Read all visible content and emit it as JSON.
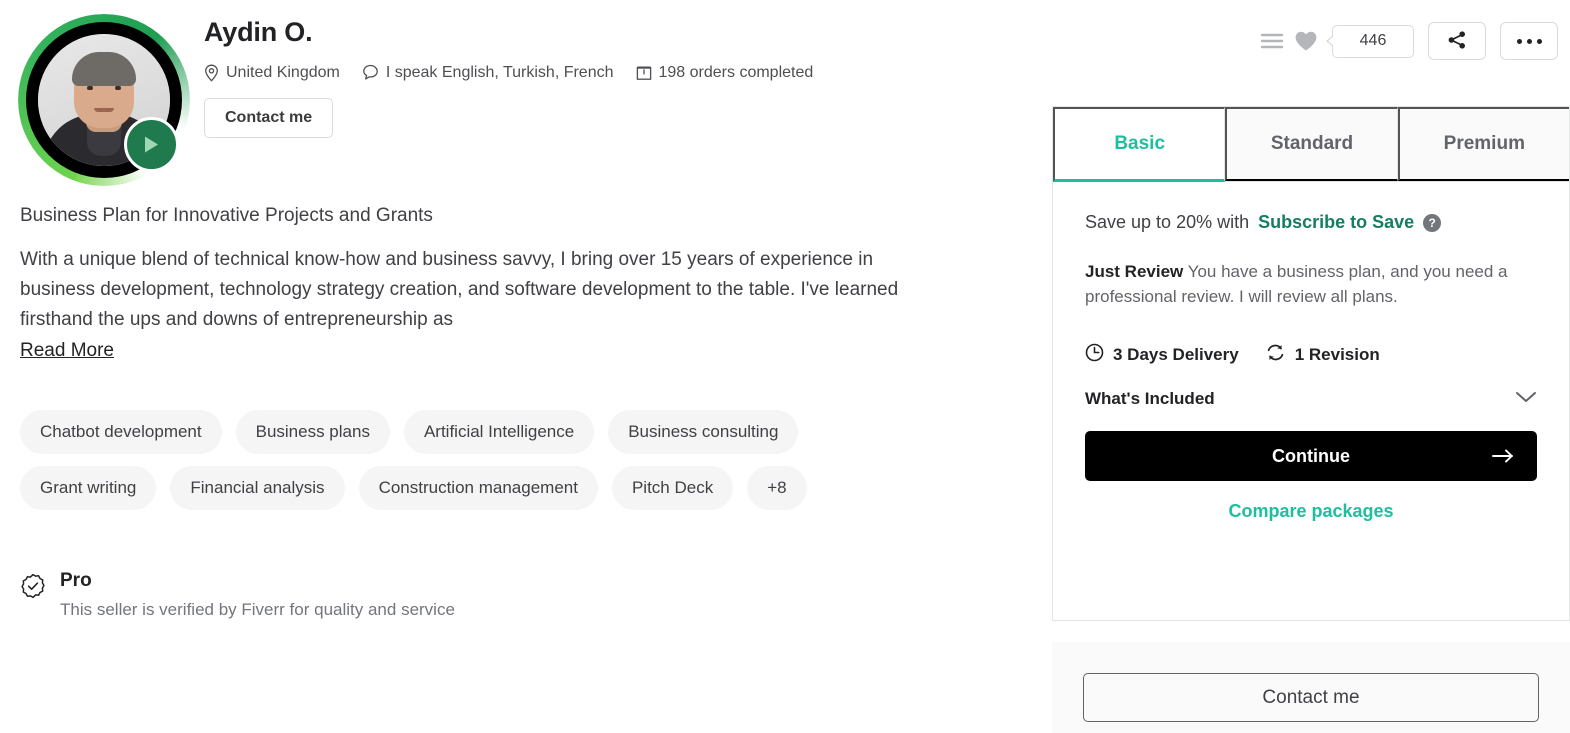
{
  "seller": {
    "name": "Aydin O.",
    "avatar_alt": "seller-avatar",
    "play_icon": "play-icon",
    "location": "United Kingdom",
    "location_icon": "location-pin-icon",
    "languages": "I speak English, Turkish, French",
    "languages_icon": "chat-bubble-icon",
    "orders": "198 orders completed",
    "orders_icon": "orders-box-icon",
    "contact_label": "Contact me"
  },
  "top_actions": {
    "collect_icon": "collect-list-icon",
    "favorite_icon": "heart-icon",
    "favorite_count": "446",
    "share_icon": "share-icon",
    "more_icon": "more-options-icon"
  },
  "gig": {
    "title": "Business Plan for Innovative Projects and Grants",
    "description": "With a unique blend of technical know-how and business savvy, I bring over 15 years of experience in business development, technology strategy creation, and software development to the table. I've learned firsthand the ups and downs of entrepreneurship as",
    "read_more_label": "Read More",
    "tags": [
      "Chatbot development",
      "Business plans",
      "Artificial Intelligence",
      "Business consulting",
      "Grant writing",
      "Financial analysis",
      "Construction management",
      "Pitch Deck",
      "+8"
    ]
  },
  "pro": {
    "icon": "verified-badge-icon",
    "title": "Pro",
    "subtitle": "This seller is verified by Fiverr for quality and service"
  },
  "package_card": {
    "tabs": [
      {
        "label": "Basic",
        "active": true
      },
      {
        "label": "Standard",
        "active": false
      },
      {
        "label": "Premium",
        "active": false
      }
    ],
    "save_prefix": "Save up to 20% with",
    "save_link": "Subscribe to Save",
    "help_icon": "help-question-icon",
    "help_glyph": "?",
    "package_name": "Just Review",
    "package_description": "You have a business plan, and you need a professional review. I will review all plans.",
    "delivery": "3 Days Delivery",
    "delivery_icon": "clock-icon",
    "revisions": "1 Revision",
    "revisions_icon": "refresh-icon",
    "whats_included": "What's Included",
    "chevron_icon": "chevron-down-icon",
    "continue_label": "Continue",
    "continue_arrow_icon": "arrow-right-icon",
    "compare_label": "Compare packages"
  },
  "contact_panel": {
    "contact_label": "Contact me"
  },
  "colors": {
    "accent_teal": "#1dbf9f",
    "link_green": "#167d63",
    "continue_bg": "#000000",
    "ring_green": "#35b45c",
    "play_bg": "#1f7a4d"
  }
}
